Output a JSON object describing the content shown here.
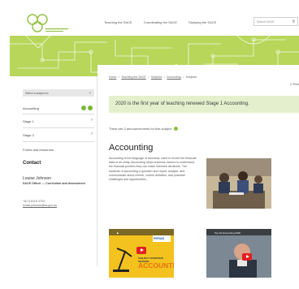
{
  "header": {
    "nav": [
      "Teaching the SACE",
      "Coordinating the SACE",
      "Studying the SACE"
    ],
    "search_placeholder": "Search SACE"
  },
  "sidebar": {
    "select_label": "Select a subject to",
    "items": [
      "Accounting",
      "Stage 1",
      "Stage 2",
      "Forms and resources"
    ],
    "contact_heading": "Contact",
    "contact_name": "Louise Johnson",
    "contact_role": "SACE Officer — Curriculum and Assessment",
    "contact_phone": "+61 8 8115 4703",
    "contact_email": "louise.johnson@sa.gov.au"
  },
  "main": {
    "breadcrumb": [
      "Home",
      "Teaching the SACE",
      "Subjects",
      "Accounting",
      "Subjects"
    ],
    "print_label": "Print",
    "notice": "2020 is the first year of teaching renewed Stage 1 Accounting.",
    "announce": "There are 2 announcements for this subject",
    "heading": "Accounting",
    "body": "Accounting is the language of business, used to record the financial data of an entity. Accounting helps business owners to understand the financial position they can make informed decisions. The students of accounting a question and report, analyse, and communicate about events, current activities, and potential challenges and opportunities.",
    "video1_badge": "PEPIAN",
    "video1_pre": "SUBJECT OVERVIEW SESSION",
    "video1_word": "ACCOUNTING",
    "video2_title": "Top 10 Accounting 2020"
  },
  "colors": {
    "accent": "#7fb439",
    "banner": "#b7d65a",
    "notice_bg": "#e4f0cd"
  }
}
